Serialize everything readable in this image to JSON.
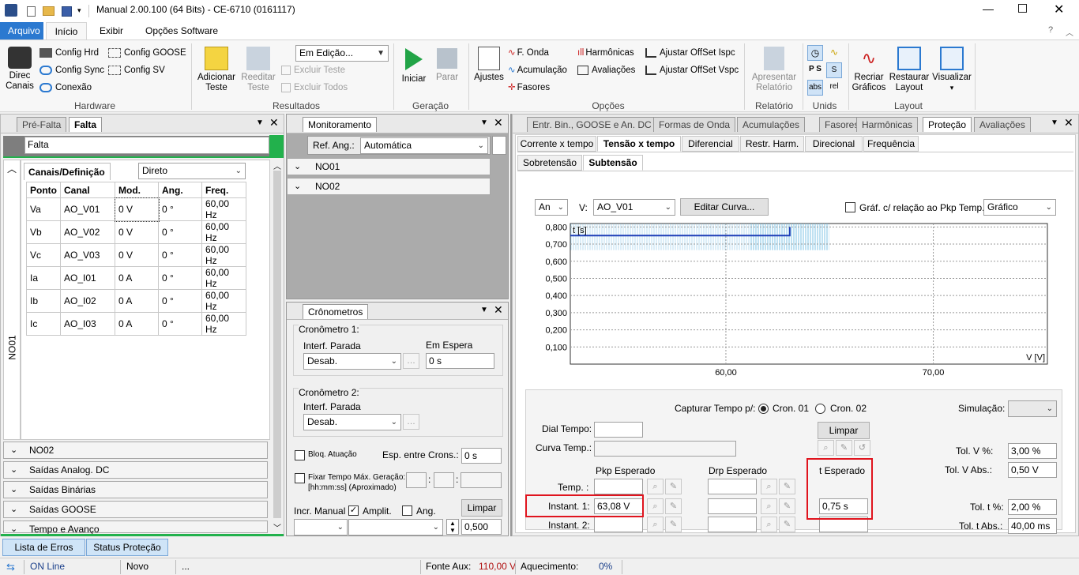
{
  "window": {
    "title": "Manual 2.00.100 (64 Bits) - CE-6710 (0161117)"
  },
  "ribbon_tabs": [
    "Arquivo",
    "Início",
    "Exibir",
    "Opções Software"
  ],
  "ribbon": {
    "hardware": {
      "label": "Hardware",
      "direc": "Direc\nCanais",
      "config_hrd": "Config Hrd",
      "config_goose": "Config GOOSE",
      "config_sync": "Config Sync",
      "config_sv": "Config SV",
      "conexao": "Conexão"
    },
    "resultados": {
      "label": "Resultados",
      "adicionar": "Adicionar\nTeste",
      "reeditar": "Reeditar\nTeste",
      "status_select": "Em Edição...",
      "excluir_teste": "Excluir Teste",
      "excluir_todos": "Excluir Todos"
    },
    "geracao": {
      "label": "Geração",
      "iniciar": "Iniciar",
      "parar": "Parar"
    },
    "opcoes": {
      "label": "Opções",
      "ajustes": "Ajustes",
      "f_onda": "F. Onda",
      "acumulacao": "Acumulação",
      "fasores": "Fasores",
      "harmonicas": "Harmônicas",
      "avaliacoes": "Avaliações",
      "ajustar_ispc": "Ajustar OffSet Ispc",
      "ajustar_vspc": "Ajustar OffSet Vspc"
    },
    "relatorio": {
      "label": "Relatório",
      "apresentar": "Apresentar\nRelatório"
    },
    "unids": {
      "label": "Unids",
      "abs": "abs",
      "rel": "rel"
    },
    "layout": {
      "label": "Layout",
      "recriar": "Recriar\nGráficos",
      "restaurar": "Restaurar\nLayout",
      "visualizar": "Visualizar"
    }
  },
  "left_panel": {
    "tabs": [
      "Pré-Falta",
      "Falta"
    ],
    "state_name": "Falta",
    "section_tab": "Canais/Definição",
    "mode_select": "Direto",
    "vertical_label": "NO01",
    "table": {
      "headers": [
        "Ponto",
        "Canal",
        "Mod.",
        "Ang.",
        "Freq."
      ],
      "rows": [
        [
          "Va",
          "AO_V01",
          "0 V",
          "0 °",
          "60,00 Hz"
        ],
        [
          "Vb",
          "AO_V02",
          "0 V",
          "0 °",
          "60,00 Hz"
        ],
        [
          "Vc",
          "AO_V03",
          "0 V",
          "0 °",
          "60,00 Hz"
        ],
        [
          "Ia",
          "AO_I01",
          "0 A",
          "0 °",
          "60,00 Hz"
        ],
        [
          "Ib",
          "AO_I02",
          "0 A",
          "0 °",
          "60,00 Hz"
        ],
        [
          "Ic",
          "AO_I03",
          "0 A",
          "0 °",
          "60,00 Hz"
        ]
      ]
    },
    "accordion": [
      "NO02",
      "Saídas Analog. DC",
      "Saídas Binárias",
      "Saídas GOOSE",
      "Tempo e Avanço"
    ]
  },
  "monitor_panel": {
    "title": "Monitoramento",
    "ref_label": "Ref. Ang.:",
    "ref_value": "Automática",
    "items": [
      "NO01",
      "NO02"
    ]
  },
  "cron_panel": {
    "title": "Crônometros",
    "cron1": {
      "title": "Cronômetro 1:",
      "interf_label": "Interf. Parada",
      "interf_value": "Desab.",
      "status_label": "Em Espera",
      "value": "0 s"
    },
    "cron2": {
      "title": "Cronômetro 2:",
      "interf_label": "Interf. Parada",
      "interf_value": "Desab."
    },
    "bloq": "Bloq. Atuação",
    "esp_label": "Esp. entre Crons.:",
    "esp_value": "0 s",
    "fixar": "Fixar Tempo Máx. Geração:",
    "fixar_fmt": "[hh:mm:ss] (Aproximado)",
    "incr_label": "Incr. Manual",
    "amplit": "Amplit.",
    "ang": "Ang.",
    "limpar": "Limpar",
    "step_value": "0,500"
  },
  "right_panel": {
    "tabs": [
      "Entr. Bin., GOOSE e An. DC",
      "Formas de Onda",
      "Acumulações",
      "Fasores",
      "Harmônicas",
      "Proteção",
      "Avaliações"
    ],
    "subtabs": [
      "Corrente x tempo",
      "Tensão x tempo",
      "Diferencial",
      "Restr. Harm.",
      "Direcional",
      "Frequência"
    ],
    "subsubtabs": [
      "Sobretensão",
      "Subtensão"
    ],
    "an_select": "An",
    "v_label": "V:",
    "v_select": "AO_V01",
    "editar_curva": "Editar Curva...",
    "graf_rel": "Gráf. c/ relação ao Pkp Temp.",
    "graf_select": "Gráfico",
    "chart_data": {
      "type": "line",
      "ylabel": "t [s]",
      "xlabel": "V [V]",
      "y_ticks": [
        "0,800",
        "0,700",
        "0,600",
        "0,500",
        "0,400",
        "0,300",
        "0,200",
        "0,100"
      ],
      "x_ticks": [
        "60,00",
        "70,00"
      ],
      "series": [
        {
          "values": [
            [
              52.5,
              0.75
            ],
            [
              63.08,
              0.75
            ],
            [
              63.08,
              0.8
            ]
          ]
        }
      ],
      "xlim": [
        52.5,
        75.5
      ],
      "ylim": [
        0,
        0.82
      ],
      "grid": true
    },
    "capturar_label": "Capturar Tempo p/:",
    "cron01": "Cron. 01",
    "cron02": "Cron. 02",
    "simulacao": "Simulação:",
    "dial_label": "Dial Tempo:",
    "limpar": "Limpar",
    "curva_label": "Curva Temp.:",
    "pkp_header": "Pkp Esperado",
    "drp_header": "Drp Esperado",
    "t_header": "t Esperado",
    "temp_label": "Temp. :",
    "inst1_label": "Instant. 1:",
    "inst2_label": "Instant. 2:",
    "inst1_pkp": "63,08 V",
    "inst1_t": "0,75 s",
    "tol_v_pct_label": "Tol. V %:",
    "tol_v_pct": "3,00 %",
    "tol_v_abs_label": "Tol. V Abs.:",
    "tol_v_abs": "0,50 V",
    "tol_t_pct_label": "Tol. t %:",
    "tol_t_pct": "2,00 %",
    "tol_t_abs_label": "Tol. t Abs.:",
    "tol_t_abs": "40,00 ms"
  },
  "bottom_tabs": [
    "Lista de Erros",
    "Status Proteção"
  ],
  "statusbar": {
    "online": "ON Line",
    "novo": "Novo",
    "dots": "...",
    "fonte_label": "Fonte Aux:",
    "fonte_value": "110,00 V",
    "aquec_label": "Aquecimento:",
    "aquec_value": "0%"
  },
  "colors": {
    "accent": "#2b79d0",
    "green": "#22b14c",
    "highlight": "#e0141e",
    "curve": "#1f3fb8",
    "hatch": "#7fc3e6"
  }
}
